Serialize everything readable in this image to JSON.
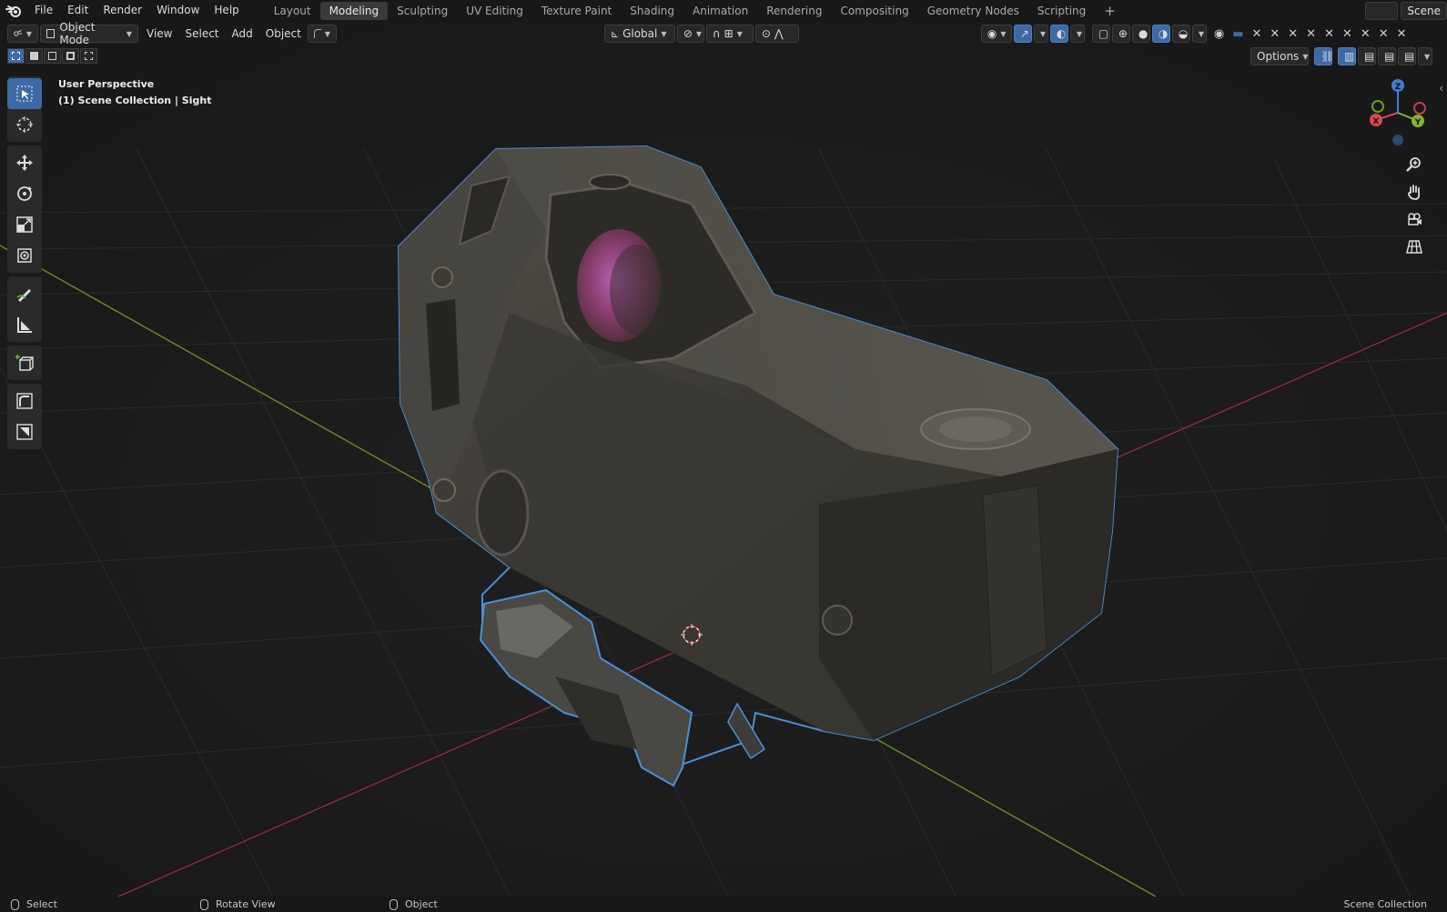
{
  "menus": [
    "File",
    "Edit",
    "Render",
    "Window",
    "Help"
  ],
  "workspaces": [
    {
      "label": "Layout",
      "active": false
    },
    {
      "label": "Modeling",
      "active": true
    },
    {
      "label": "Sculpting",
      "active": false
    },
    {
      "label": "UV Editing",
      "active": false
    },
    {
      "label": "Texture Paint",
      "active": false
    },
    {
      "label": "Shading",
      "active": false
    },
    {
      "label": "Animation",
      "active": false
    },
    {
      "label": "Rendering",
      "active": false
    },
    {
      "label": "Compositing",
      "active": false
    },
    {
      "label": "Geometry Nodes",
      "active": false
    },
    {
      "label": "Scripting",
      "active": false
    }
  ],
  "add_workspace": "+",
  "scene_name": "Scene",
  "header": {
    "mode": "Object Mode",
    "view": "View",
    "select": "Select",
    "add": "Add",
    "object": "Object",
    "orientation": "Global",
    "options": "Options"
  },
  "overlay": {
    "perspective": "User Perspective",
    "collection": "(1) Scene Collection | Sight"
  },
  "gizmo": {
    "x": "X",
    "y": "Y",
    "z": "Z"
  },
  "status": {
    "left": "Select",
    "middle": "Rotate View",
    "right": "Object",
    "far_right": "Scene Collection"
  },
  "colors": {
    "accent": "#3d6aa5",
    "axis_x": "#e0455a",
    "axis_y": "#86b42b",
    "axis_z": "#3d7fd1",
    "selection_outline": "#4a8fd8"
  },
  "icons": [
    "blender-logo-icon",
    "select-box-icon",
    "cursor-icon",
    "move-icon",
    "rotate-icon",
    "scale-icon",
    "transform-icon",
    "annotate-icon",
    "measure-icon",
    "add-cube-icon",
    "shear-icon",
    "add-primitive-icon",
    "zoom-icon",
    "pan-hand-icon",
    "camera-icon",
    "grid-icon"
  ]
}
